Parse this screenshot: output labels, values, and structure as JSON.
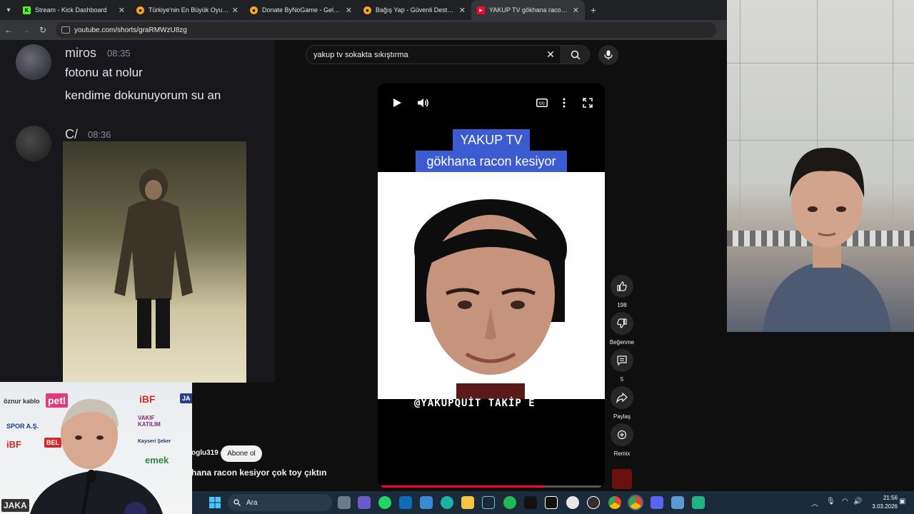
{
  "browser": {
    "tabs": [
      {
        "label": "Stream - Kick Dashboard",
        "favicon": "kick-icon",
        "color": "#53fc18",
        "active": false
      },
      {
        "label": "Türkiye'nin En Büyük Oyuncu D",
        "favicon": "bynogame-icon",
        "color": "#f5a623",
        "active": false
      },
      {
        "label": "Donate ByNoGame - Gelen/Gi",
        "favicon": "bynogame-icon",
        "color": "#f5a623",
        "active": false
      },
      {
        "label": "Bağış Yap - Güvenli Destek | By",
        "favicon": "bynogame-icon",
        "color": "#f5a623",
        "active": false
      },
      {
        "label": "YAKUP TV gökhana racon kesiyo",
        "favicon": "youtube-icon",
        "color": "#ff0033",
        "active": true
      }
    ],
    "url": "youtube.com/shorts/graRMWzU8zg"
  },
  "chat": {
    "messages": [
      {
        "user": "miros",
        "time": "08:35",
        "lines": [
          "fotonu at nolur",
          "kendime dokunuyorum su an"
        ]
      },
      {
        "user": "C/",
        "time": "08:36",
        "lines": []
      }
    ]
  },
  "youtube": {
    "search": {
      "value": "yakup tv sokakta sıkıştırma"
    },
    "player": {
      "title_line1": "YAKUP TV",
      "title_line2": "gökhana racon kesiyor",
      "overlay_text": "@YAKUPQUİT TAKİP E",
      "progress": 0.74
    },
    "actions": {
      "like_count": "198",
      "dislike_label": "Beğenme",
      "comments_count": "5",
      "share_label": "Paylaş",
      "remix_label": "Remix"
    },
    "channel_suffix": "oglu319",
    "subscribe_label": "Abone ol",
    "video_title": "hana racon kesiyor çok toy çıktın"
  },
  "coach_overlay": {
    "sponsors": [
      "öznur kablo",
      "petl",
      "iBF",
      "JA",
      "SPOR A.Ş.",
      "VAKIF KATILIM",
      "iBF",
      "BEL",
      "Kayseri Şeker",
      "emek",
      "JAKA"
    ]
  },
  "taskbar": {
    "search_placeholder": "Ara",
    "time": "21:56",
    "date": "3.03.2026"
  },
  "colors": {
    "accent_red": "#ff0033",
    "title_blue": "#3d5bd0",
    "kick_green": "#53fc18"
  }
}
